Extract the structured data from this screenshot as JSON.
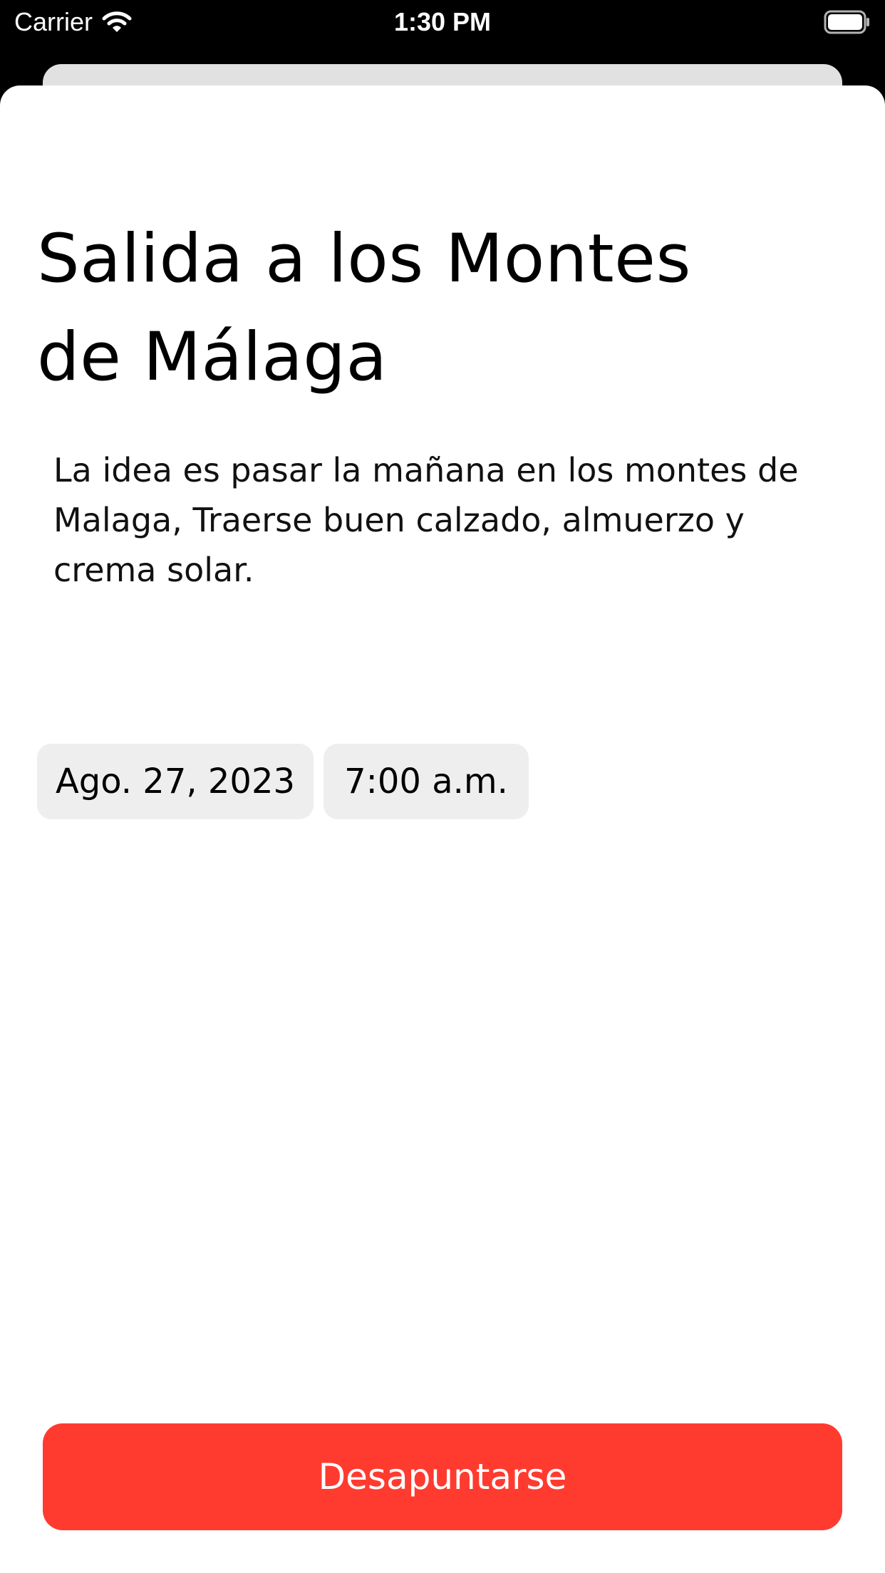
{
  "status_bar": {
    "carrier": "Carrier",
    "time": "1:30 PM",
    "icons": [
      "wifi-icon",
      "battery-icon"
    ]
  },
  "event": {
    "title": "Salida a los Montes de Málaga",
    "description": "La idea es pasar la mañana en los montes de Malaga, Traerse buen calzado, almuerzo y crema solar.",
    "date": "Ago. 27, 2023",
    "time": "7:00 a.m."
  },
  "actions": {
    "unsubscribe_label": "Desapuntarse"
  },
  "colors": {
    "accent": "#ff3b30",
    "chip_background": "#eeeeef",
    "back_sheet": "#e1e1e1"
  }
}
